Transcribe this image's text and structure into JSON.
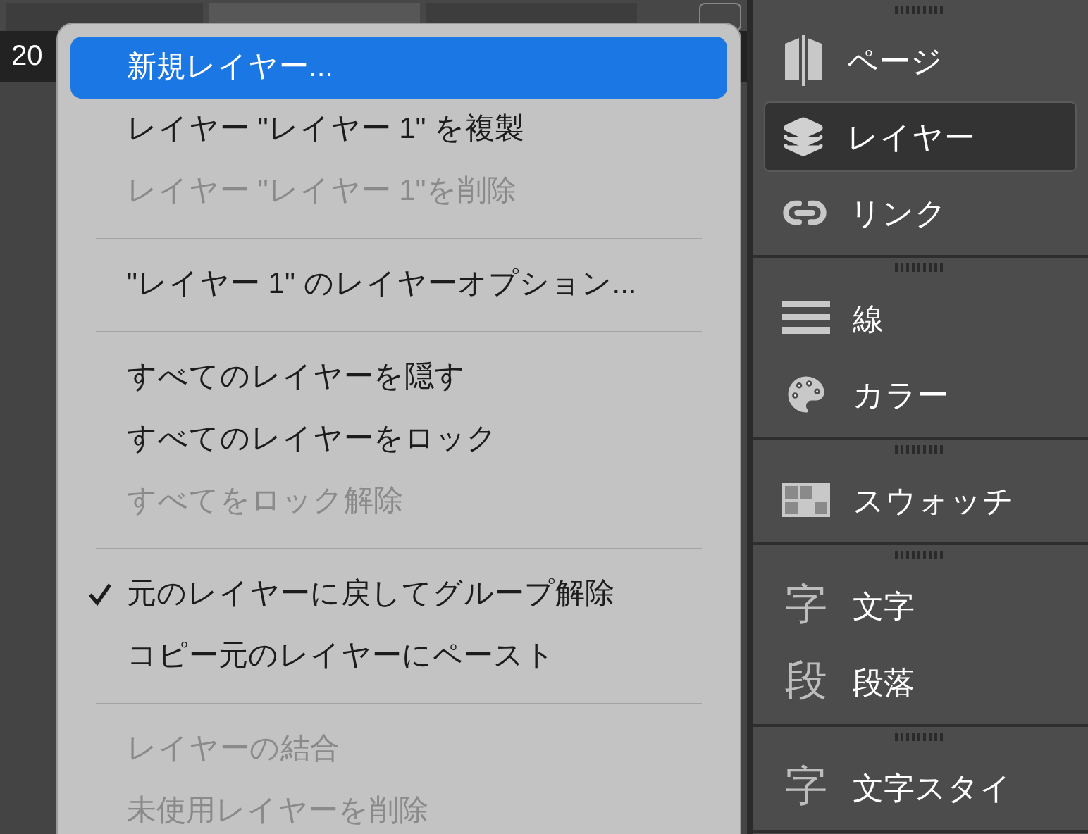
{
  "ruler": {
    "value": "20"
  },
  "menu": {
    "items": [
      {
        "kind": "item",
        "label": "新規レイヤー...",
        "selected": true,
        "disabled": false,
        "checked": false
      },
      {
        "kind": "item",
        "label": "レイヤー \"レイヤー 1\" を複製",
        "selected": false,
        "disabled": false,
        "checked": false
      },
      {
        "kind": "item",
        "label": "レイヤー \"レイヤー 1\"を削除",
        "selected": false,
        "disabled": true,
        "checked": false
      },
      {
        "kind": "separator"
      },
      {
        "kind": "item",
        "label": "\"レイヤー 1\" のレイヤーオプション...",
        "selected": false,
        "disabled": false,
        "checked": false
      },
      {
        "kind": "separator"
      },
      {
        "kind": "item",
        "label": "すべてのレイヤーを隠す",
        "selected": false,
        "disabled": false,
        "checked": false
      },
      {
        "kind": "item",
        "label": "すべてのレイヤーをロック",
        "selected": false,
        "disabled": false,
        "checked": false
      },
      {
        "kind": "item",
        "label": "すべてをロック解除",
        "selected": false,
        "disabled": true,
        "checked": false
      },
      {
        "kind": "separator"
      },
      {
        "kind": "item",
        "label": "元のレイヤーに戻してグループ解除",
        "selected": false,
        "disabled": false,
        "checked": true
      },
      {
        "kind": "item",
        "label": "コピー元のレイヤーにペースト",
        "selected": false,
        "disabled": false,
        "checked": false
      },
      {
        "kind": "separator"
      },
      {
        "kind": "item",
        "label": "レイヤーの結合",
        "selected": false,
        "disabled": true,
        "checked": false
      },
      {
        "kind": "item",
        "label": "未使用レイヤーを削除",
        "selected": false,
        "disabled": true,
        "checked": false
      }
    ]
  },
  "panel": {
    "sections": [
      {
        "items": [
          {
            "kind": "page",
            "label": "ページ",
            "selected": false
          },
          {
            "kind": "layers",
            "label": "レイヤー",
            "selected": true
          },
          {
            "kind": "link",
            "label": "リンク",
            "selected": false
          }
        ]
      },
      {
        "items": [
          {
            "kind": "lines",
            "label": "線",
            "selected": false
          },
          {
            "kind": "palette",
            "label": "カラー",
            "selected": false
          }
        ]
      },
      {
        "items": [
          {
            "kind": "swatch",
            "label": "スウォッチ",
            "selected": false
          }
        ]
      },
      {
        "items": [
          {
            "kind": "glyph",
            "glyph": "字",
            "label": "文字",
            "selected": false
          },
          {
            "kind": "glyph",
            "glyph": "段",
            "label": "段落",
            "selected": false
          }
        ]
      },
      {
        "items": [
          {
            "kind": "glyph",
            "glyph": "字",
            "label": "文字スタイ",
            "selected": false
          }
        ]
      }
    ]
  }
}
